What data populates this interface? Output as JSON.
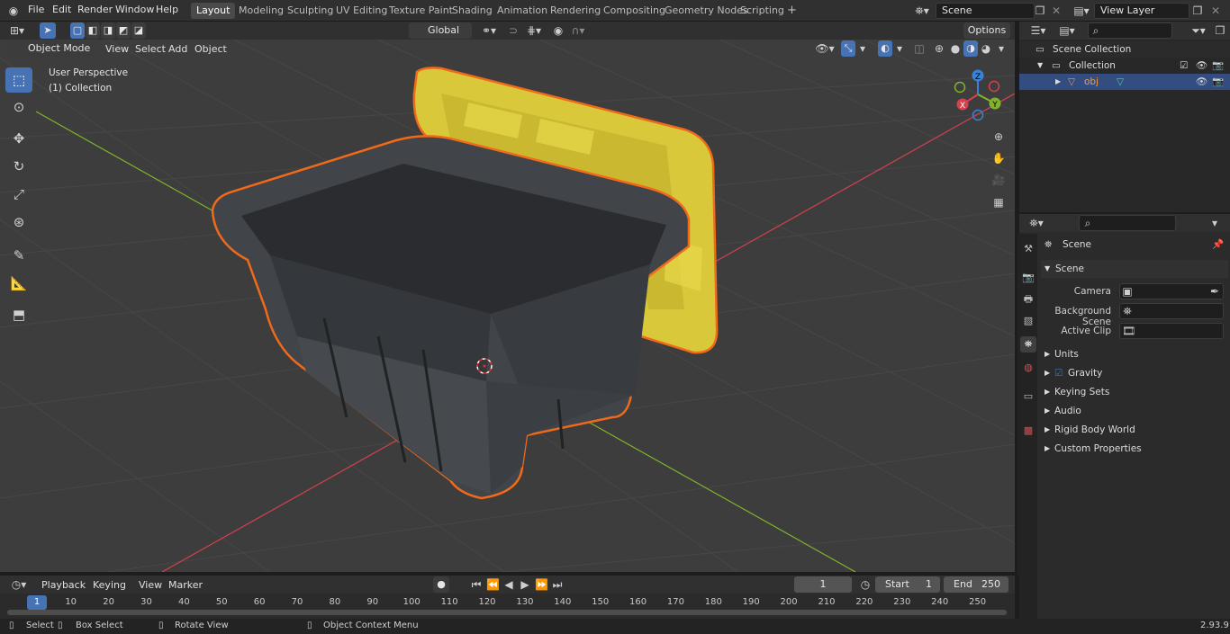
{
  "menu": {
    "items": [
      "File",
      "Edit",
      "Render",
      "Window",
      "Help"
    ]
  },
  "workspaces": {
    "tabs": [
      "Layout",
      "Modeling",
      "Sculpting",
      "UV Editing",
      "Texture Paint",
      "Shading",
      "Animation",
      "Rendering",
      "Compositing",
      "Geometry Nodes",
      "Scripting"
    ],
    "active": "Layout",
    "add_symbol": "+"
  },
  "scene_field": {
    "value": "Scene"
  },
  "view_layer_field": {
    "value": "View Layer"
  },
  "viewport_header": {
    "mode": "Object Mode",
    "menus": [
      "View",
      "Select",
      "Add",
      "Object"
    ],
    "transform_orientation": "Global",
    "options_label": "Options"
  },
  "viewport": {
    "perspective_label": "User Perspective",
    "collection_label": "(1) Collection",
    "gizmo": {
      "x": "X",
      "y": "Y",
      "z": "Z"
    }
  },
  "outliner": {
    "search_placeholder": "",
    "rows": [
      {
        "label": "Scene Collection"
      },
      {
        "label": "Collection"
      },
      {
        "label": "obj"
      }
    ]
  },
  "properties": {
    "context_title": "Scene",
    "scene_panel": "Scene",
    "fields": [
      {
        "label": "Camera",
        "value": ""
      },
      {
        "label": "Background Scene",
        "value": ""
      },
      {
        "label": "Active Clip",
        "value": ""
      }
    ],
    "panels": [
      "Units",
      "Gravity",
      "Keying Sets",
      "Audio",
      "Rigid Body World",
      "Custom Properties"
    ]
  },
  "timeline": {
    "menus": [
      "Playback",
      "Keying",
      "View",
      "Marker"
    ],
    "current_frame": "1",
    "start_label": "Start",
    "start_value": "1",
    "end_label": "End",
    "end_value": "250",
    "ticks": [
      "1",
      "10",
      "20",
      "30",
      "40",
      "50",
      "60",
      "70",
      "80",
      "90",
      "100",
      "110",
      "120",
      "130",
      "140",
      "150",
      "160",
      "170",
      "180",
      "190",
      "200",
      "210",
      "220",
      "230",
      "240",
      "250"
    ]
  },
  "statusbar": {
    "hints": [
      "Select",
      "Box Select",
      "Rotate View",
      "Object Context Menu"
    ],
    "version": "2.93.9"
  },
  "colors": {
    "accent": "#4772b3",
    "selection_outline": "#f06a1a",
    "lid": "#d9c93a",
    "axis_x": "#d4414f",
    "axis_y": "#7fb32a",
    "axis_z": "#3a82d8"
  }
}
